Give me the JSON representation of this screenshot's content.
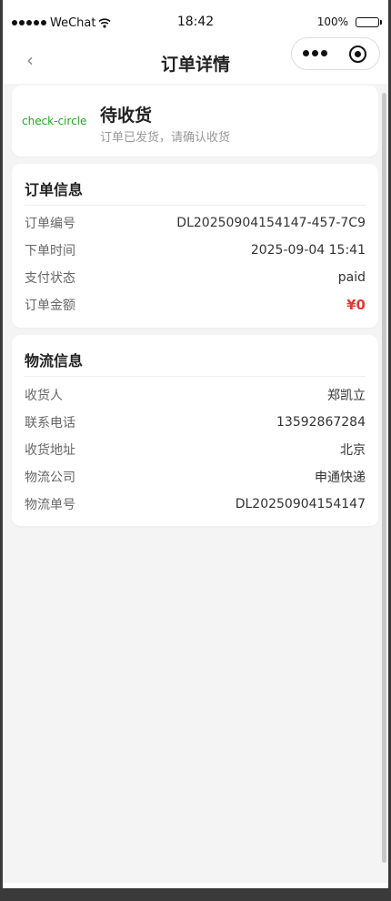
{
  "status_bar": {
    "carrier": "WeChat",
    "time": "18:42",
    "battery": "100%"
  },
  "nav": {
    "back_icon": "chevron-left-icon",
    "title": "订单详情",
    "menu_icon": "more-dots-icon",
    "close_icon": "target-circle-icon"
  },
  "status_card": {
    "icon_label": "check-circle",
    "icon_color": "#1aad19",
    "title": "待收货",
    "subtitle": "订单已发货，请确认收货"
  },
  "order_info": {
    "title": "订单信息",
    "rows": [
      {
        "label": "订单编号",
        "value": "DL20250904154147-457-7C9"
      },
      {
        "label": "下单时间",
        "value": "2025-09-04 15:41"
      },
      {
        "label": "支付状态",
        "value": "paid"
      },
      {
        "label": "订单金额",
        "value": "¥0"
      }
    ]
  },
  "logistics_info": {
    "title": "物流信息",
    "rows": [
      {
        "label": "收货人",
        "value": "郑凯立"
      },
      {
        "label": "联系电话",
        "value": "13592867284"
      },
      {
        "label": "收货地址",
        "value": "北京"
      },
      {
        "label": "物流公司",
        "value": "申通快递"
      },
      {
        "label": "物流单号",
        "value": "DL20250904154147"
      }
    ]
  },
  "colors": {
    "accent_green": "#1aad19",
    "price_red": "#e53935",
    "page_bg": "#f4f4f4"
  }
}
